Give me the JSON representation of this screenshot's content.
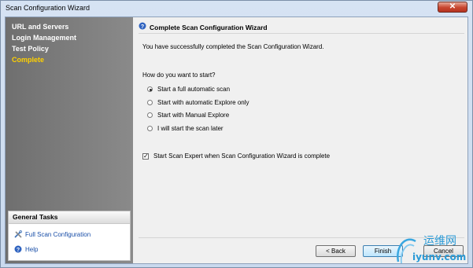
{
  "window": {
    "title": "Scan Configuration Wizard"
  },
  "sidebar": {
    "items": [
      {
        "label": "URL and Servers"
      },
      {
        "label": "Login Management"
      },
      {
        "label": "Test Policy"
      },
      {
        "label": "Complete"
      }
    ],
    "tasks": {
      "header": "General Tasks",
      "items": [
        {
          "label": "Full Scan Configuration"
        },
        {
          "label": "Help"
        }
      ]
    }
  },
  "main": {
    "heading": "Complete Scan Configuration Wizard",
    "intro": "You have successfully completed the Scan Configuration Wizard.",
    "question": "How do you want to start?",
    "options": [
      {
        "label": "Start a full automatic scan"
      },
      {
        "label": "Start with automatic Explore only"
      },
      {
        "label": "Start with Manual Explore"
      },
      {
        "label": "I will start the scan later"
      }
    ],
    "checkbox_label": "Start Scan Expert when Scan Configuration Wizard is complete"
  },
  "buttons": {
    "back": "< Back",
    "finish": "Finish",
    "cancel": "Cancel"
  },
  "watermark": {
    "text1": "运维网",
    "text2": "iyunv.com"
  }
}
